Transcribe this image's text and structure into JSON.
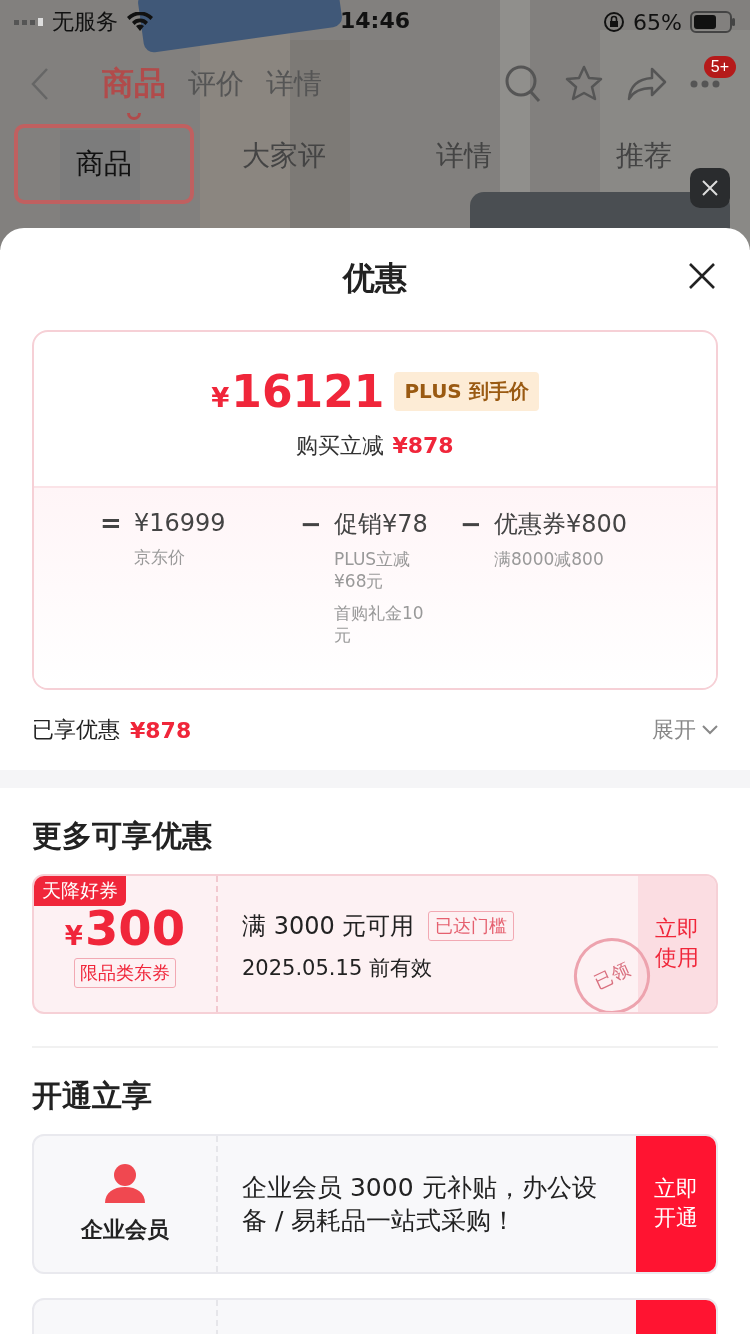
{
  "status_bar": {
    "carrier": "无服务",
    "time": "14:46",
    "battery": "65%"
  },
  "nav": {
    "tabs": [
      {
        "label": "商品",
        "selected": true
      },
      {
        "label": "评价",
        "selected": false
      },
      {
        "label": "详情",
        "selected": false
      }
    ],
    "badge": "5+"
  },
  "anchor_tabs": [
    {
      "label": "商品",
      "selected": true
    },
    {
      "label": "大家评",
      "selected": false
    },
    {
      "label": "详情",
      "selected": false
    },
    {
      "label": "推荐",
      "selected": false
    }
  ],
  "sheet": {
    "title": "优惠",
    "price_card": {
      "currency": "¥",
      "price": "16121",
      "tag": "PLUS 到手价",
      "reduce_label": "购买立减",
      "reduce_amount": "¥878",
      "breakdown": [
        {
          "operator": "=",
          "amount": "¥16999",
          "notes": [
            "京东价"
          ]
        },
        {
          "operator": "−",
          "amount": "促销¥78",
          "notes": [
            "PLUS立减¥68元",
            "首购礼金10元"
          ]
        },
        {
          "operator": "−",
          "amount": "优惠券¥800",
          "notes": [
            "满8000减800"
          ]
        }
      ]
    },
    "enjoyed": {
      "label": "已享优惠",
      "amount": "¥878",
      "expand": "展开"
    },
    "more": {
      "title": "更多可享优惠",
      "coupons": [
        {
          "ribbon": "天降好券",
          "currency": "¥",
          "amount": "300",
          "scope": "限品类东券",
          "condition": "满 3000 元可用",
          "badge": "已达门槛",
          "validity": "2025.05.15 前有效",
          "action": "立即使用",
          "stamp": "已领"
        }
      ]
    },
    "membership": {
      "title": "开通立享",
      "offers": [
        {
          "kind": "full",
          "name": "企业会员",
          "desc": "企业会员 3000 元补贴，办公设备 / 易耗品一站式采购！",
          "action": "立即开通"
        },
        {
          "kind": "peek"
        }
      ]
    }
  }
}
